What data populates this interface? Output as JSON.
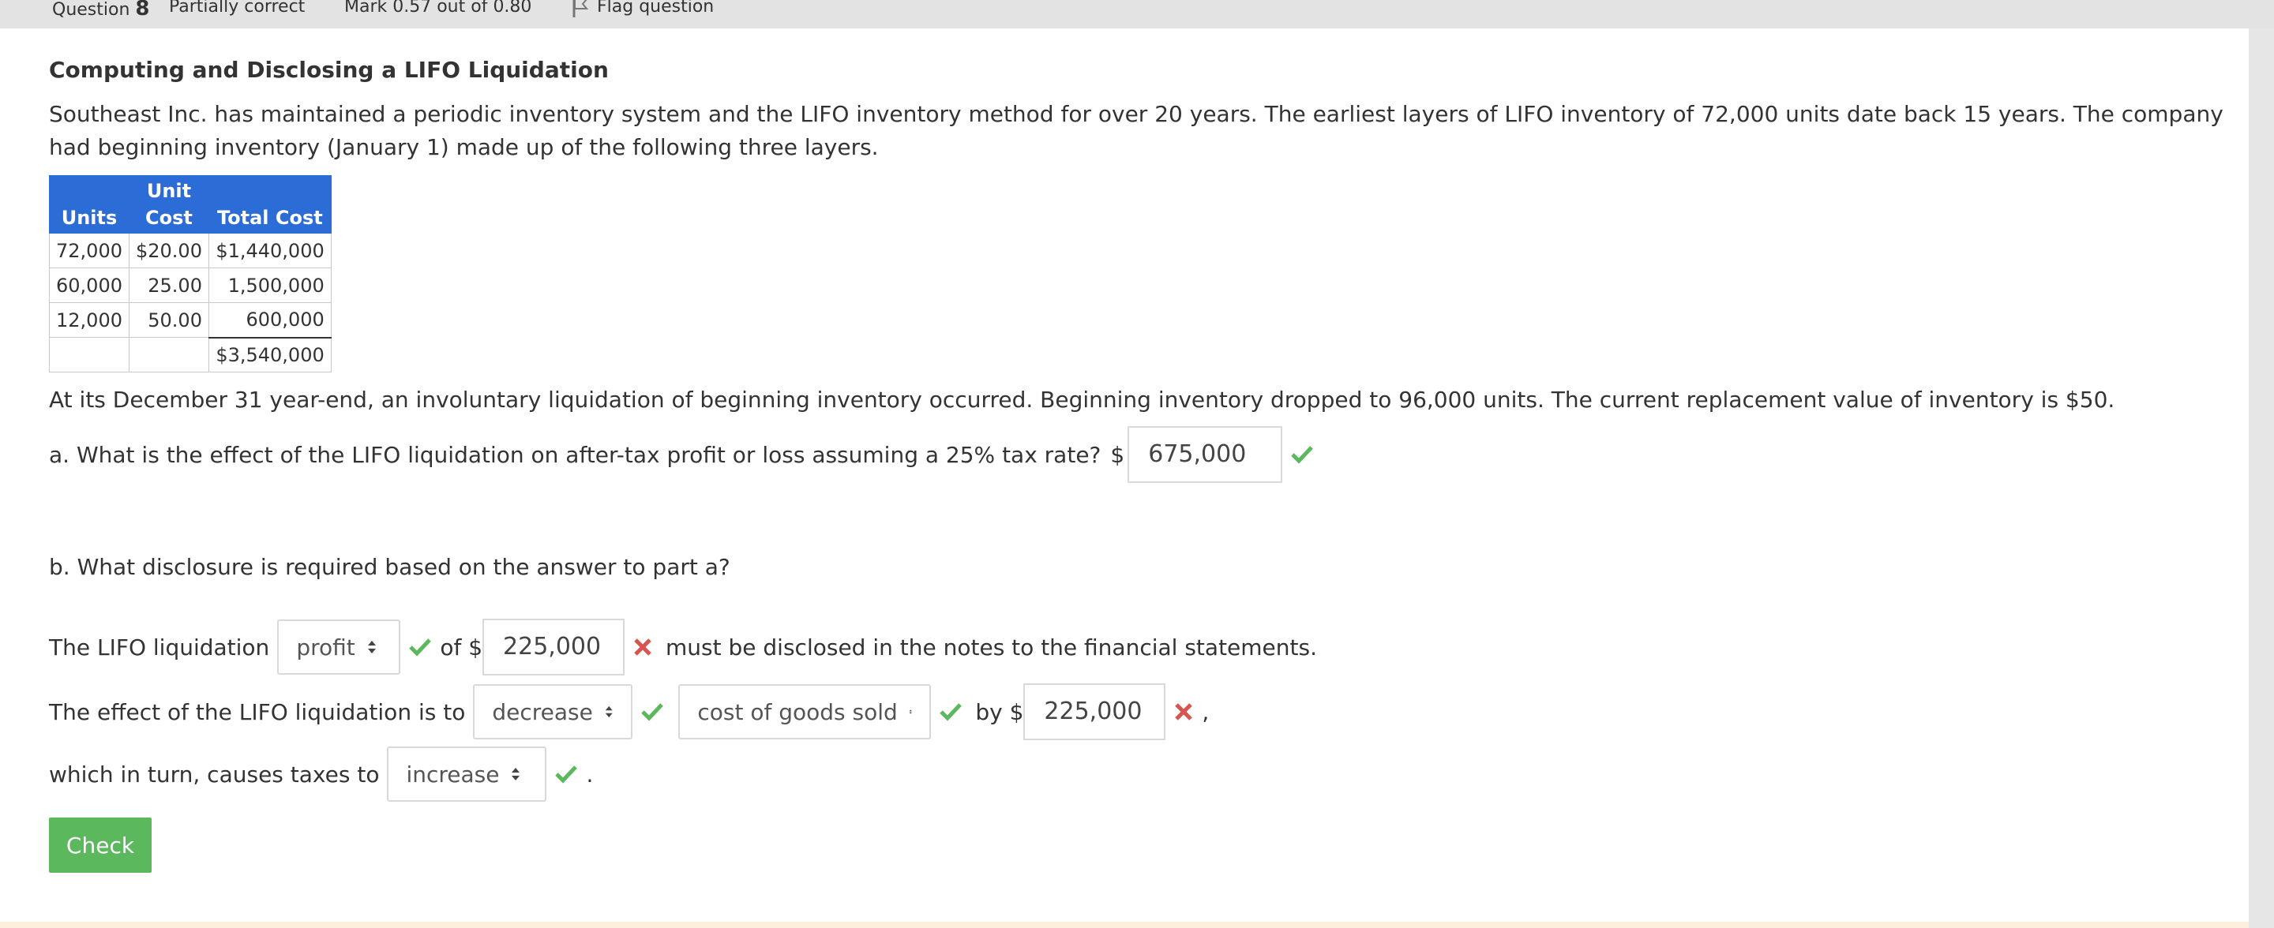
{
  "info": {
    "question_label": "Question",
    "question_number": "8",
    "state": "Partially correct",
    "mark": "Mark 0.57 out of 0.80",
    "flag": "Flag question"
  },
  "question": {
    "title": "Computing and Disclosing a LIFO Liquidation",
    "intro": "Southeast Inc. has maintained a periodic inventory system and the LIFO inventory method for over 20 years. The earliest layers of LIFO inventory of 72,000 units date back 15 years. The company had beginning inventory (January 1) made up of the following three layers.",
    "table": {
      "headers": [
        "Units",
        "Unit\nCost",
        "Total Cost"
      ],
      "rows": [
        [
          "72,000",
          "$20.00",
          "$1,440,000"
        ],
        [
          "60,000",
          "25.00",
          "1,500,000"
        ],
        [
          "12,000",
          "50.00",
          "600,000"
        ]
      ],
      "total": "$3,540,000"
    },
    "context": "At its December 31 year-end, an involuntary liquidation of beginning inventory occurred. Beginning inventory dropped to 96,000 units. The current replacement value of inventory is $50.",
    "part_a": {
      "text": "a. What is the effect of the LIFO liquidation on after-tax profit or loss assuming a 25% tax rate?",
      "currency": "$",
      "answer": "675,000"
    },
    "part_b": {
      "text": "b. What disclosure is required based on the answer to part a?",
      "line1": {
        "prefix": "The LIFO liquidation",
        "select": "profit",
        "of": "of $",
        "amount": "225,000",
        "suffix": "must be disclosed in the notes to the financial statements."
      },
      "line2": {
        "prefix": "The effect of the LIFO liquidation is to",
        "select1": "decrease",
        "select2": "cost of goods sold",
        "by": "by $",
        "amount": "225,000",
        "comma": ","
      },
      "line3": {
        "prefix": "which in turn, causes taxes to",
        "select": "increase",
        "period": "."
      }
    }
  },
  "actions": {
    "check": "Check"
  },
  "colors": {
    "correct": "#5cb85c",
    "incorrect": "#d9534f",
    "table_header": "#2c6cd6"
  }
}
